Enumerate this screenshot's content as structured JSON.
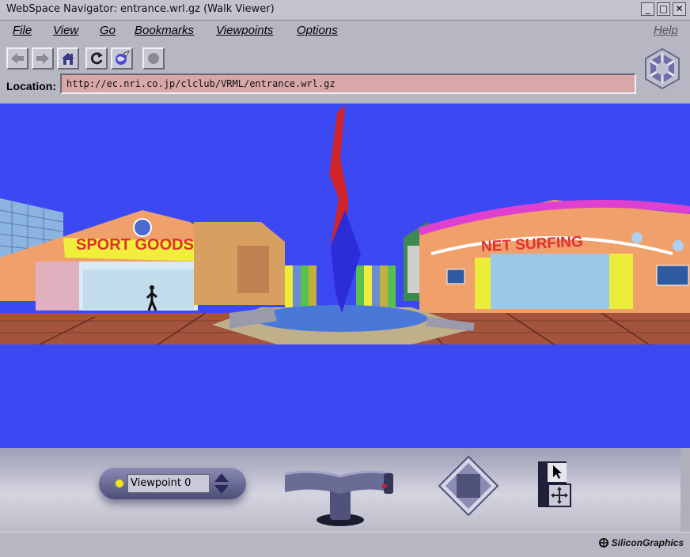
{
  "window": {
    "title": "WebSpace Navigator: entrance.wrl.gz (Walk Viewer)",
    "controls": [
      "_",
      "□",
      "✕"
    ]
  },
  "menubar": {
    "items": [
      {
        "label": "File"
      },
      {
        "label": "View"
      },
      {
        "label": "Go"
      },
      {
        "label": "Bookmarks"
      },
      {
        "label": "Viewpoints"
      },
      {
        "label": "Options"
      }
    ],
    "help_label": "Help"
  },
  "toolbar": {
    "buttons": [
      "back-arrow-icon",
      "forward-arrow-icon",
      "home-icon",
      "reload-icon",
      "open-world-icon",
      "stop-icon"
    ]
  },
  "location": {
    "label": "Location:",
    "url": "http://ec.nri.co.jp/clclub/VRML/entrance.wrl.gz"
  },
  "scene": {
    "sign_left": "SPORT GOODS",
    "sign_right": "NET SURFING",
    "sky_color": "#3c49f2"
  },
  "dashboard": {
    "viewpoint_label": "Viewpoint 0"
  },
  "status": {
    "brand": "SiliconGraphics"
  }
}
